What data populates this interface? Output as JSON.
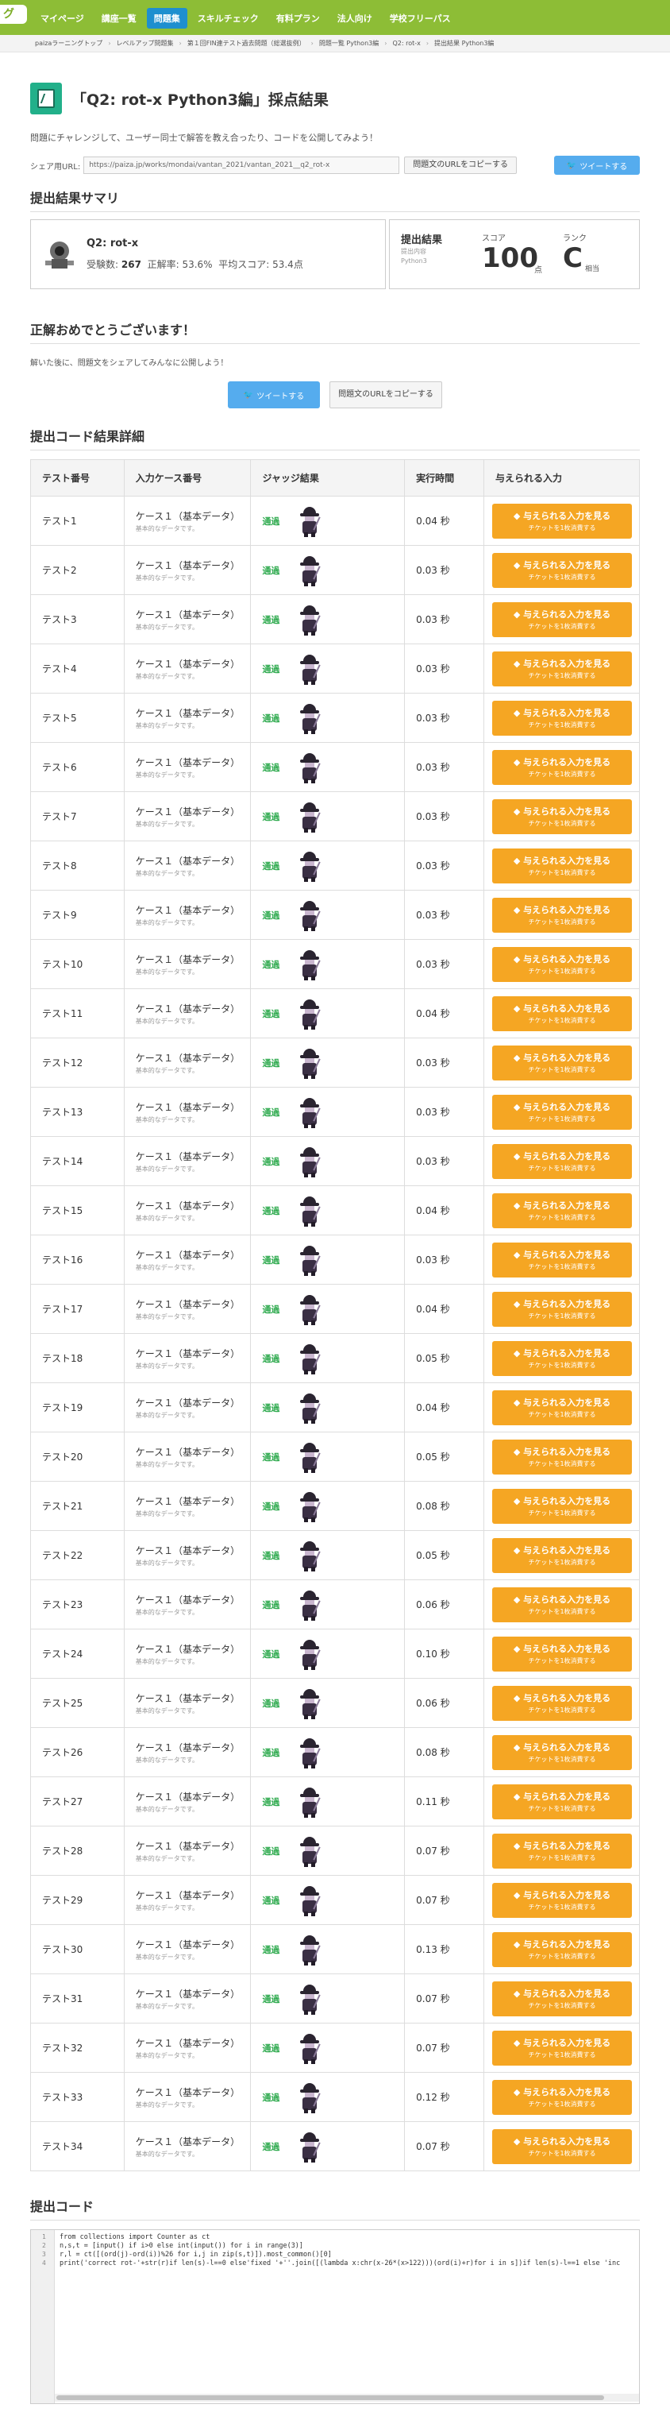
{
  "nav": {
    "logo": "グ",
    "items": [
      "マイページ",
      "講座一覧",
      "問題集",
      "スキルチェック",
      "有料プラン",
      "法人向け",
      "学校フリーパス"
    ],
    "active_index": 2
  },
  "breadcrumb": [
    "paizaラーニングトップ",
    "レベルアップ問題集",
    "第１回FIN連テスト過去問題（総選抜例）",
    "問題一覧 Python3編",
    "Q2: rot-x",
    "提出結果 Python3編"
  ],
  "page": {
    "title": "「Q2: rot-x Python3編」採点結果",
    "description": "問題にチャレンジして、ユーザー同士で解答を教え合ったり、コードを公開してみよう！",
    "share_label": "シェア用URL:",
    "share_url": "https://paiza.jp/works/mondai/vantan_2021/vantan_2021__q2_rot-x",
    "copy_url_button": "問題文のURLをコピーする",
    "tweet_button": "ツイートする"
  },
  "summary": {
    "heading": "提出結果サマリ",
    "problem_name": "Q2: rot-x",
    "stats_label_submitters": "受験数:",
    "submitters": "267",
    "stats_label_rate": "正解率:",
    "rate": "53.6%",
    "stats_label_avg": "平均スコア:",
    "avg_score": "53.4点",
    "result_label": "提出結果",
    "result_sub": "提出内容\nPython3",
    "score_label": "スコア",
    "score": "100",
    "score_unit": "点",
    "rank_label": "ランク",
    "rank": "C",
    "rank_unit": "相当"
  },
  "congrats": {
    "heading": "正解おめでとうございます！",
    "text": "解いた後に、問題文をシェアしてみんなに公開しよう！",
    "tweet_button": "ツイートする",
    "copy_button": "問題文のURLをコピーする"
  },
  "details": {
    "heading": "提出コード結果詳細",
    "columns": [
      "テスト番号",
      "入力ケース番号",
      "ジャッジ結果",
      "実行時間",
      "与えられる入力"
    ],
    "case_label": "ケース１（基本データ）",
    "case_note": "基本的なデータです。",
    "pass_label": "通過",
    "button_main": "与えられる入力を見る",
    "button_sub": "チケットを1枚消費する",
    "rows": [
      {
        "test": "テスト1",
        "time": "0.04 秒"
      },
      {
        "test": "テスト2",
        "time": "0.03 秒"
      },
      {
        "test": "テスト3",
        "time": "0.03 秒"
      },
      {
        "test": "テスト4",
        "time": "0.03 秒"
      },
      {
        "test": "テスト5",
        "time": "0.03 秒"
      },
      {
        "test": "テスト6",
        "time": "0.03 秒"
      },
      {
        "test": "テスト7",
        "time": "0.03 秒"
      },
      {
        "test": "テスト8",
        "time": "0.03 秒"
      },
      {
        "test": "テスト9",
        "time": "0.03 秒"
      },
      {
        "test": "テスト10",
        "time": "0.03 秒"
      },
      {
        "test": "テスト11",
        "time": "0.04 秒"
      },
      {
        "test": "テスト12",
        "time": "0.03 秒"
      },
      {
        "test": "テスト13",
        "time": "0.03 秒"
      },
      {
        "test": "テスト14",
        "time": "0.03 秒"
      },
      {
        "test": "テスト15",
        "time": "0.04 秒"
      },
      {
        "test": "テスト16",
        "time": "0.03 秒"
      },
      {
        "test": "テスト17",
        "time": "0.04 秒"
      },
      {
        "test": "テスト18",
        "time": "0.05 秒"
      },
      {
        "test": "テスト19",
        "time": "0.04 秒"
      },
      {
        "test": "テスト20",
        "time": "0.05 秒"
      },
      {
        "test": "テスト21",
        "time": "0.08 秒"
      },
      {
        "test": "テスト22",
        "time": "0.05 秒"
      },
      {
        "test": "テスト23",
        "time": "0.06 秒"
      },
      {
        "test": "テスト24",
        "time": "0.10 秒"
      },
      {
        "test": "テスト25",
        "time": "0.06 秒"
      },
      {
        "test": "テスト26",
        "time": "0.08 秒"
      },
      {
        "test": "テスト27",
        "time": "0.11 秒"
      },
      {
        "test": "テスト28",
        "time": "0.07 秒"
      },
      {
        "test": "テスト29",
        "time": "0.07 秒"
      },
      {
        "test": "テスト30",
        "time": "0.13 秒"
      },
      {
        "test": "テスト31",
        "time": "0.07 秒"
      },
      {
        "test": "テスト32",
        "time": "0.07 秒"
      },
      {
        "test": "テスト33",
        "time": "0.12 秒"
      },
      {
        "test": "テスト34",
        "time": "0.07 秒"
      }
    ]
  },
  "code": {
    "heading": "提出コード",
    "lines": [
      "from collections import Counter as ct",
      "n,s,t = [input() if i>0 else int(input()) for i in range(3)]",
      "r,l = ct([(ord(j)-ord(i))%26 for i,j in zip(s,t)]).most_common()[0]",
      "print('correct rot-'+str(r)if len(s)-l==0 else'fixed '+''.join([(lambda x:chr(x-26*(x>122)))(ord(i)+r)for i in s])if len(s)-l==1 else 'inc"
    ]
  },
  "colors": {
    "nav_green": "#8dbd36",
    "nav_active": "#1e8fcf",
    "tweet_blue": "#55acee",
    "orange_button": "#f5a623",
    "pass_green": "#2eaa4e",
    "book_icon": "#22b08a"
  }
}
